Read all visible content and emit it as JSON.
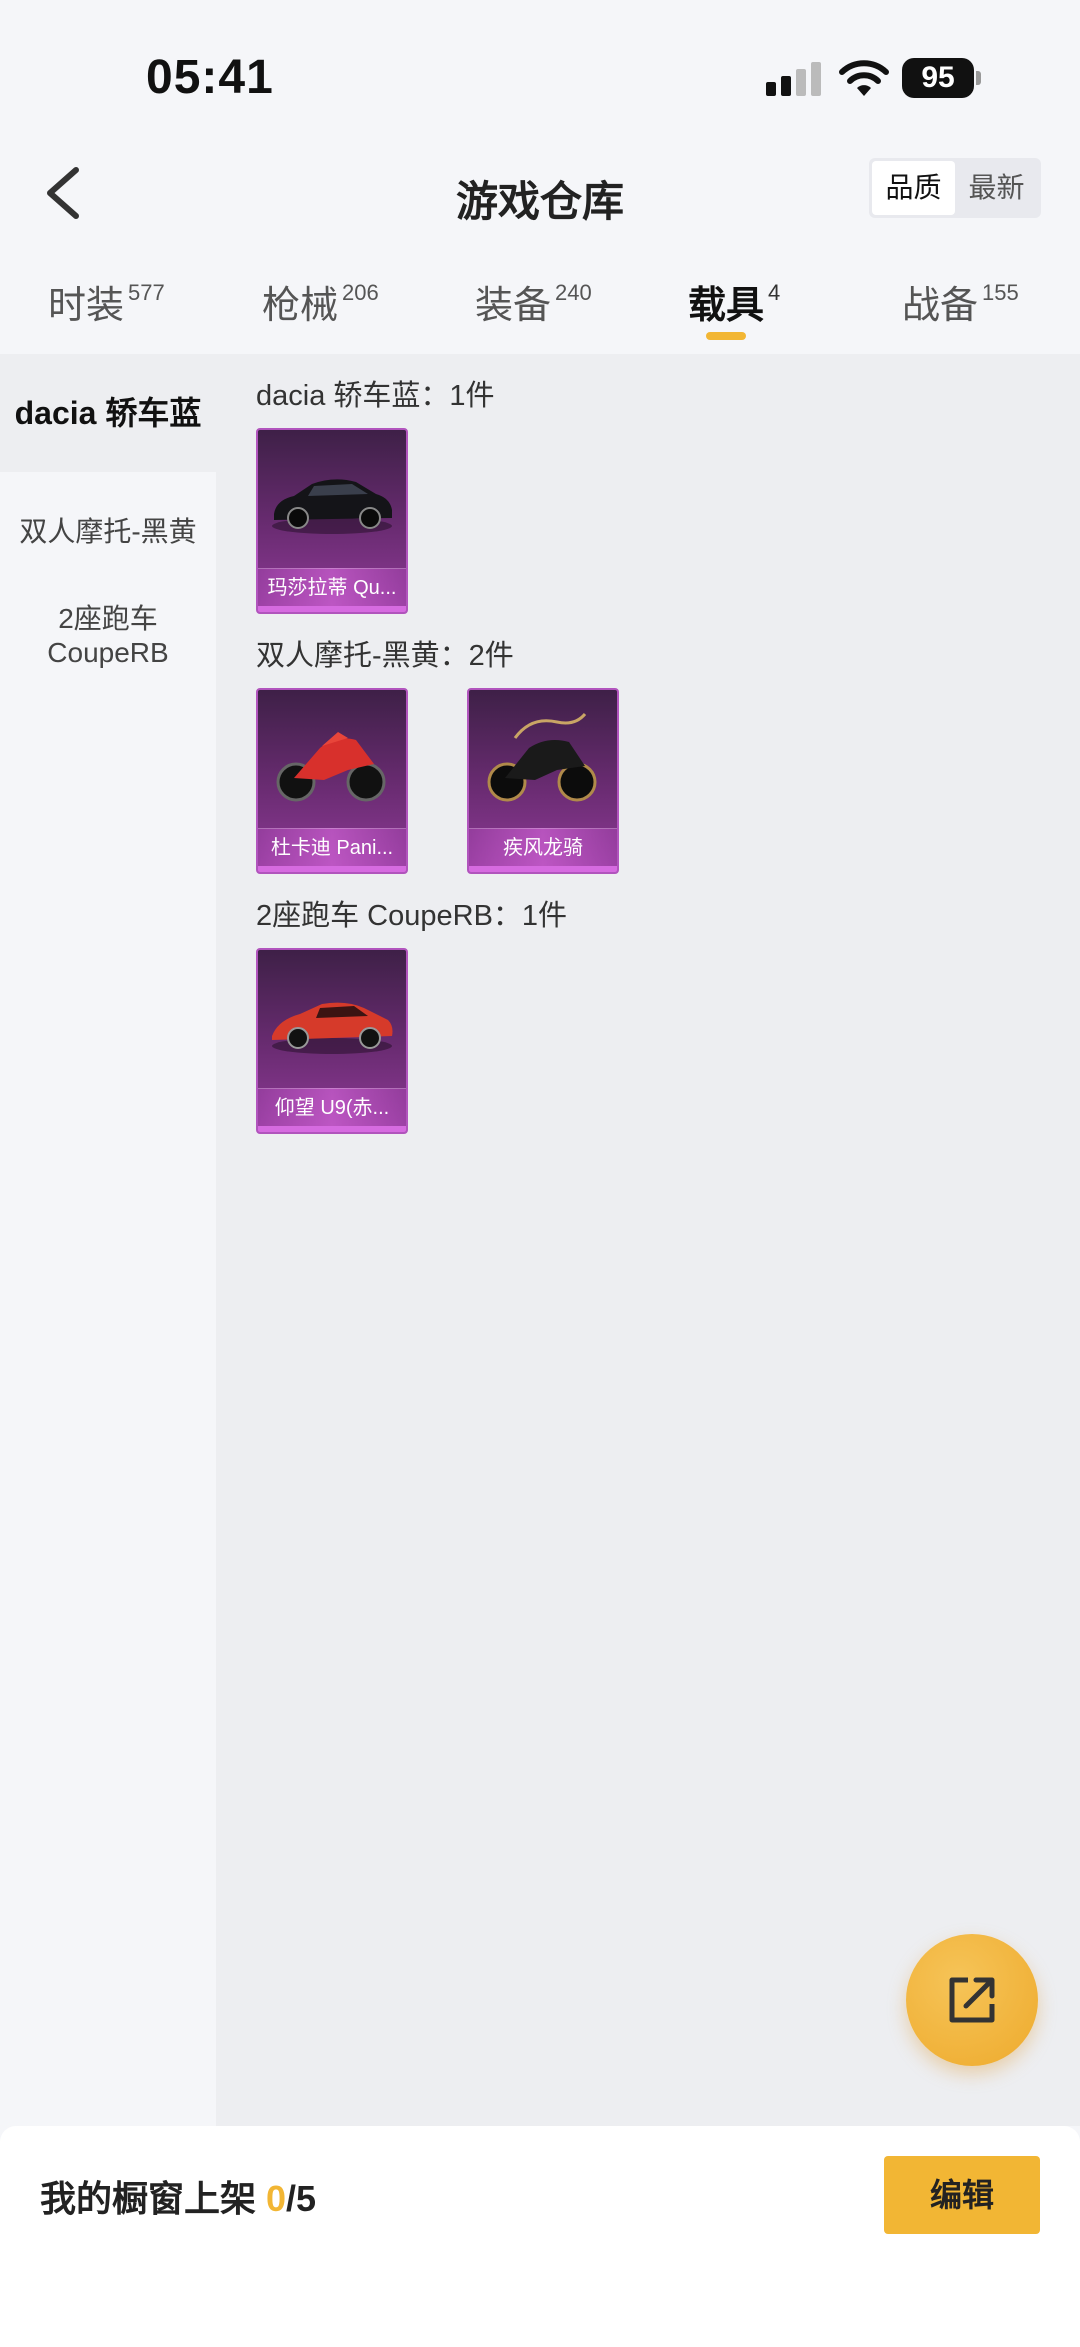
{
  "status_bar": {
    "time": "05:41",
    "battery": "95"
  },
  "header": {
    "title": "游戏仓库",
    "sort_options": [
      "品质",
      "最新"
    ]
  },
  "tabs": [
    {
      "label": "时装",
      "count": "577"
    },
    {
      "label": "枪械",
      "count": "206"
    },
    {
      "label": "装备",
      "count": "240"
    },
    {
      "label": "载具",
      "count": "4"
    },
    {
      "label": "战备",
      "count": "155"
    }
  ],
  "sidebar": {
    "items": [
      "dacia 轿车蓝",
      "双人摩托-黑黄",
      "2座跑车 CoupeRB"
    ]
  },
  "groups": [
    {
      "title": "dacia 轿车蓝：1件",
      "items": [
        "玛莎拉蒂 Qu..."
      ]
    },
    {
      "title": "双人摩托-黑黄：2件",
      "items": [
        "杜卡迪 Pani...",
        "疾风龙骑"
      ]
    },
    {
      "title": "2座跑车 CoupeRB：1件",
      "items": [
        "仰望 U9(赤..."
      ]
    }
  ],
  "bottom_bar": {
    "label": "我的橱窗上架 ",
    "current": "0",
    "total": "/5",
    "edit_label": "编辑"
  },
  "colors": {
    "accent": "#f2b634",
    "card_purple": "#6b2c73"
  },
  "icons": [
    "back-arrow-icon",
    "signal-icon",
    "wifi-icon",
    "battery-icon",
    "share-icon"
  ]
}
